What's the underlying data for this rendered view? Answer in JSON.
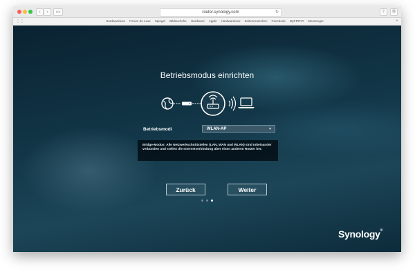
{
  "browser": {
    "url": "router.synology.com",
    "bookmarks": [
      "Hardwareluxx",
      "Forum de Luxx",
      "Spiegel",
      "Bildsuchche",
      "Hardware",
      "Apple",
      "Hardwareluxx",
      "Zeitenmarschen",
      "Facebook",
      "MyFRITZ!",
      "Messenger"
    ]
  },
  "icons": {
    "globe": "globe-icon",
    "modem": "modem-icon",
    "router": "wifi-router-icon",
    "signal": "wireless-signal-icon",
    "laptop": "laptop-icon"
  },
  "wizard": {
    "title": "Betriebsmodus einrichten",
    "mode_label": "Betriebsmodi",
    "mode_value": "WLAN-AP",
    "description": "Bridge-Modus: Alle Netzwerkschnittstellen (LAN, WAN und WLAN) sind miteinander verbunden und stellen die Internetverbindung über einen anderen Router her.",
    "back_label": "Zurück",
    "next_label": "Weiter",
    "page_dots": 3,
    "active_dot": 2
  },
  "brand": {
    "name": "Synology",
    "mark": "®"
  },
  "colors": {
    "titlebar": "#e9e9e9",
    "background": "#123748",
    "button_border": "#b8c8d0"
  }
}
